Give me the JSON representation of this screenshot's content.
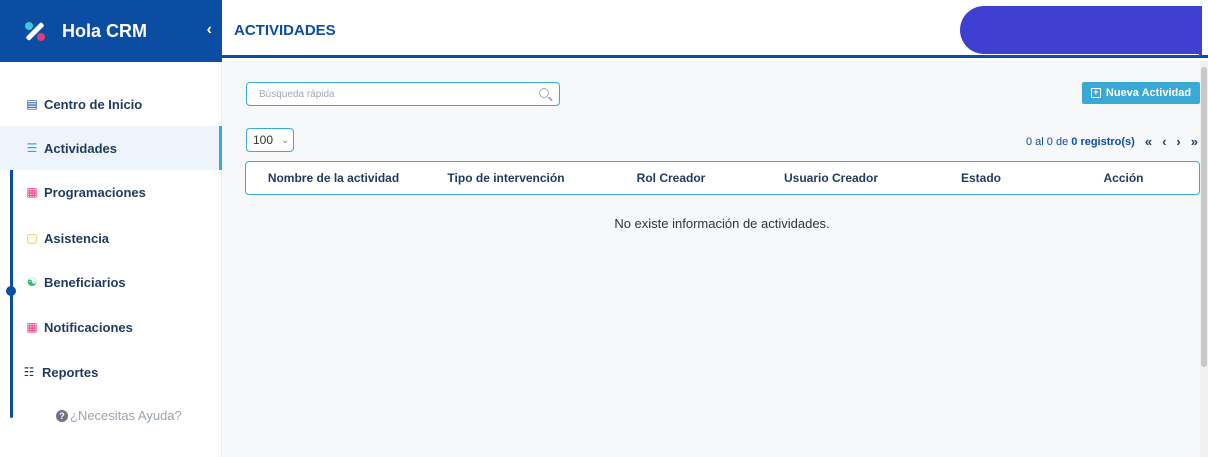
{
  "app": {
    "name": "Hola CRM",
    "collapse_icon": "chevron-left-icon"
  },
  "header": {
    "title": "ACTIVIDADES"
  },
  "sidebar": {
    "items": [
      {
        "label": "Centro de Inicio",
        "icon": "home-icon",
        "color": "#0b4da2"
      },
      {
        "label": "Actividades",
        "icon": "list-icon",
        "color": "#3aa9d6",
        "active": true
      },
      {
        "label": "Programaciones",
        "icon": "calendar-icon",
        "color": "#e5397a"
      },
      {
        "label": "Asistencia",
        "icon": "document-icon",
        "color": "#f2b21c"
      },
      {
        "label": "Beneficiarios",
        "icon": "users-icon",
        "color": "#2bbf6b"
      },
      {
        "label": "Notificaciones",
        "icon": "bell-icon",
        "color": "#e5397a"
      },
      {
        "label": "Reportes",
        "icon": "table-icon",
        "color": "#1f3a5f"
      }
    ],
    "help_text": "¿Necesitas Ayuda?"
  },
  "toolbar": {
    "search_placeholder": "Búsqueda rápida",
    "new_button_label": "Nueva Actividad",
    "page_size": "100"
  },
  "pagination": {
    "prefix": "0 al 0 de",
    "count": "0",
    "suffix": "registro(s)",
    "first": "«",
    "prev": "‹",
    "next": "›",
    "last": "»"
  },
  "table": {
    "columns": [
      "Nombre de la actividad",
      "Tipo de intervención",
      "Rol Creador",
      "Usuario Creador",
      "Estado",
      "Acción"
    ],
    "empty_message": "No existe información de actividades."
  },
  "colors": {
    "brand": "#0b4da2",
    "accent": "#3aa9d6",
    "blob": "#3f3fd1"
  }
}
